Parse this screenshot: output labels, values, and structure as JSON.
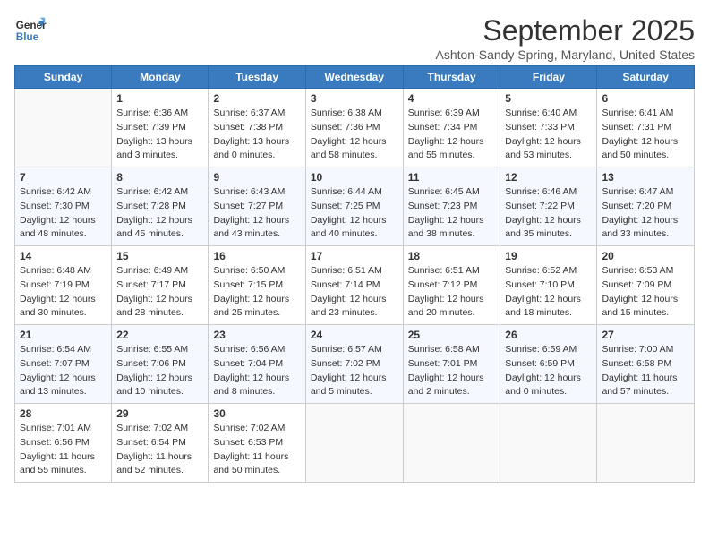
{
  "header": {
    "logo_line1": "General",
    "logo_line2": "Blue",
    "month": "September 2025",
    "location": "Ashton-Sandy Spring, Maryland, United States"
  },
  "weekdays": [
    "Sunday",
    "Monday",
    "Tuesday",
    "Wednesday",
    "Thursday",
    "Friday",
    "Saturday"
  ],
  "weeks": [
    [
      {
        "day": "",
        "info": ""
      },
      {
        "day": "1",
        "info": "Sunrise: 6:36 AM\nSunset: 7:39 PM\nDaylight: 13 hours\nand 3 minutes."
      },
      {
        "day": "2",
        "info": "Sunrise: 6:37 AM\nSunset: 7:38 PM\nDaylight: 13 hours\nand 0 minutes."
      },
      {
        "day": "3",
        "info": "Sunrise: 6:38 AM\nSunset: 7:36 PM\nDaylight: 12 hours\nand 58 minutes."
      },
      {
        "day": "4",
        "info": "Sunrise: 6:39 AM\nSunset: 7:34 PM\nDaylight: 12 hours\nand 55 minutes."
      },
      {
        "day": "5",
        "info": "Sunrise: 6:40 AM\nSunset: 7:33 PM\nDaylight: 12 hours\nand 53 minutes."
      },
      {
        "day": "6",
        "info": "Sunrise: 6:41 AM\nSunset: 7:31 PM\nDaylight: 12 hours\nand 50 minutes."
      }
    ],
    [
      {
        "day": "7",
        "info": "Sunrise: 6:42 AM\nSunset: 7:30 PM\nDaylight: 12 hours\nand 48 minutes."
      },
      {
        "day": "8",
        "info": "Sunrise: 6:42 AM\nSunset: 7:28 PM\nDaylight: 12 hours\nand 45 minutes."
      },
      {
        "day": "9",
        "info": "Sunrise: 6:43 AM\nSunset: 7:27 PM\nDaylight: 12 hours\nand 43 minutes."
      },
      {
        "day": "10",
        "info": "Sunrise: 6:44 AM\nSunset: 7:25 PM\nDaylight: 12 hours\nand 40 minutes."
      },
      {
        "day": "11",
        "info": "Sunrise: 6:45 AM\nSunset: 7:23 PM\nDaylight: 12 hours\nand 38 minutes."
      },
      {
        "day": "12",
        "info": "Sunrise: 6:46 AM\nSunset: 7:22 PM\nDaylight: 12 hours\nand 35 minutes."
      },
      {
        "day": "13",
        "info": "Sunrise: 6:47 AM\nSunset: 7:20 PM\nDaylight: 12 hours\nand 33 minutes."
      }
    ],
    [
      {
        "day": "14",
        "info": "Sunrise: 6:48 AM\nSunset: 7:19 PM\nDaylight: 12 hours\nand 30 minutes."
      },
      {
        "day": "15",
        "info": "Sunrise: 6:49 AM\nSunset: 7:17 PM\nDaylight: 12 hours\nand 28 minutes."
      },
      {
        "day": "16",
        "info": "Sunrise: 6:50 AM\nSunset: 7:15 PM\nDaylight: 12 hours\nand 25 minutes."
      },
      {
        "day": "17",
        "info": "Sunrise: 6:51 AM\nSunset: 7:14 PM\nDaylight: 12 hours\nand 23 minutes."
      },
      {
        "day": "18",
        "info": "Sunrise: 6:51 AM\nSunset: 7:12 PM\nDaylight: 12 hours\nand 20 minutes."
      },
      {
        "day": "19",
        "info": "Sunrise: 6:52 AM\nSunset: 7:10 PM\nDaylight: 12 hours\nand 18 minutes."
      },
      {
        "day": "20",
        "info": "Sunrise: 6:53 AM\nSunset: 7:09 PM\nDaylight: 12 hours\nand 15 minutes."
      }
    ],
    [
      {
        "day": "21",
        "info": "Sunrise: 6:54 AM\nSunset: 7:07 PM\nDaylight: 12 hours\nand 13 minutes."
      },
      {
        "day": "22",
        "info": "Sunrise: 6:55 AM\nSunset: 7:06 PM\nDaylight: 12 hours\nand 10 minutes."
      },
      {
        "day": "23",
        "info": "Sunrise: 6:56 AM\nSunset: 7:04 PM\nDaylight: 12 hours\nand 8 minutes."
      },
      {
        "day": "24",
        "info": "Sunrise: 6:57 AM\nSunset: 7:02 PM\nDaylight: 12 hours\nand 5 minutes."
      },
      {
        "day": "25",
        "info": "Sunrise: 6:58 AM\nSunset: 7:01 PM\nDaylight: 12 hours\nand 2 minutes."
      },
      {
        "day": "26",
        "info": "Sunrise: 6:59 AM\nSunset: 6:59 PM\nDaylight: 12 hours\nand 0 minutes."
      },
      {
        "day": "27",
        "info": "Sunrise: 7:00 AM\nSunset: 6:58 PM\nDaylight: 11 hours\nand 57 minutes."
      }
    ],
    [
      {
        "day": "28",
        "info": "Sunrise: 7:01 AM\nSunset: 6:56 PM\nDaylight: 11 hours\nand 55 minutes."
      },
      {
        "day": "29",
        "info": "Sunrise: 7:02 AM\nSunset: 6:54 PM\nDaylight: 11 hours\nand 52 minutes."
      },
      {
        "day": "30",
        "info": "Sunrise: 7:02 AM\nSunset: 6:53 PM\nDaylight: 11 hours\nand 50 minutes."
      },
      {
        "day": "",
        "info": ""
      },
      {
        "day": "",
        "info": ""
      },
      {
        "day": "",
        "info": ""
      },
      {
        "day": "",
        "info": ""
      }
    ]
  ]
}
